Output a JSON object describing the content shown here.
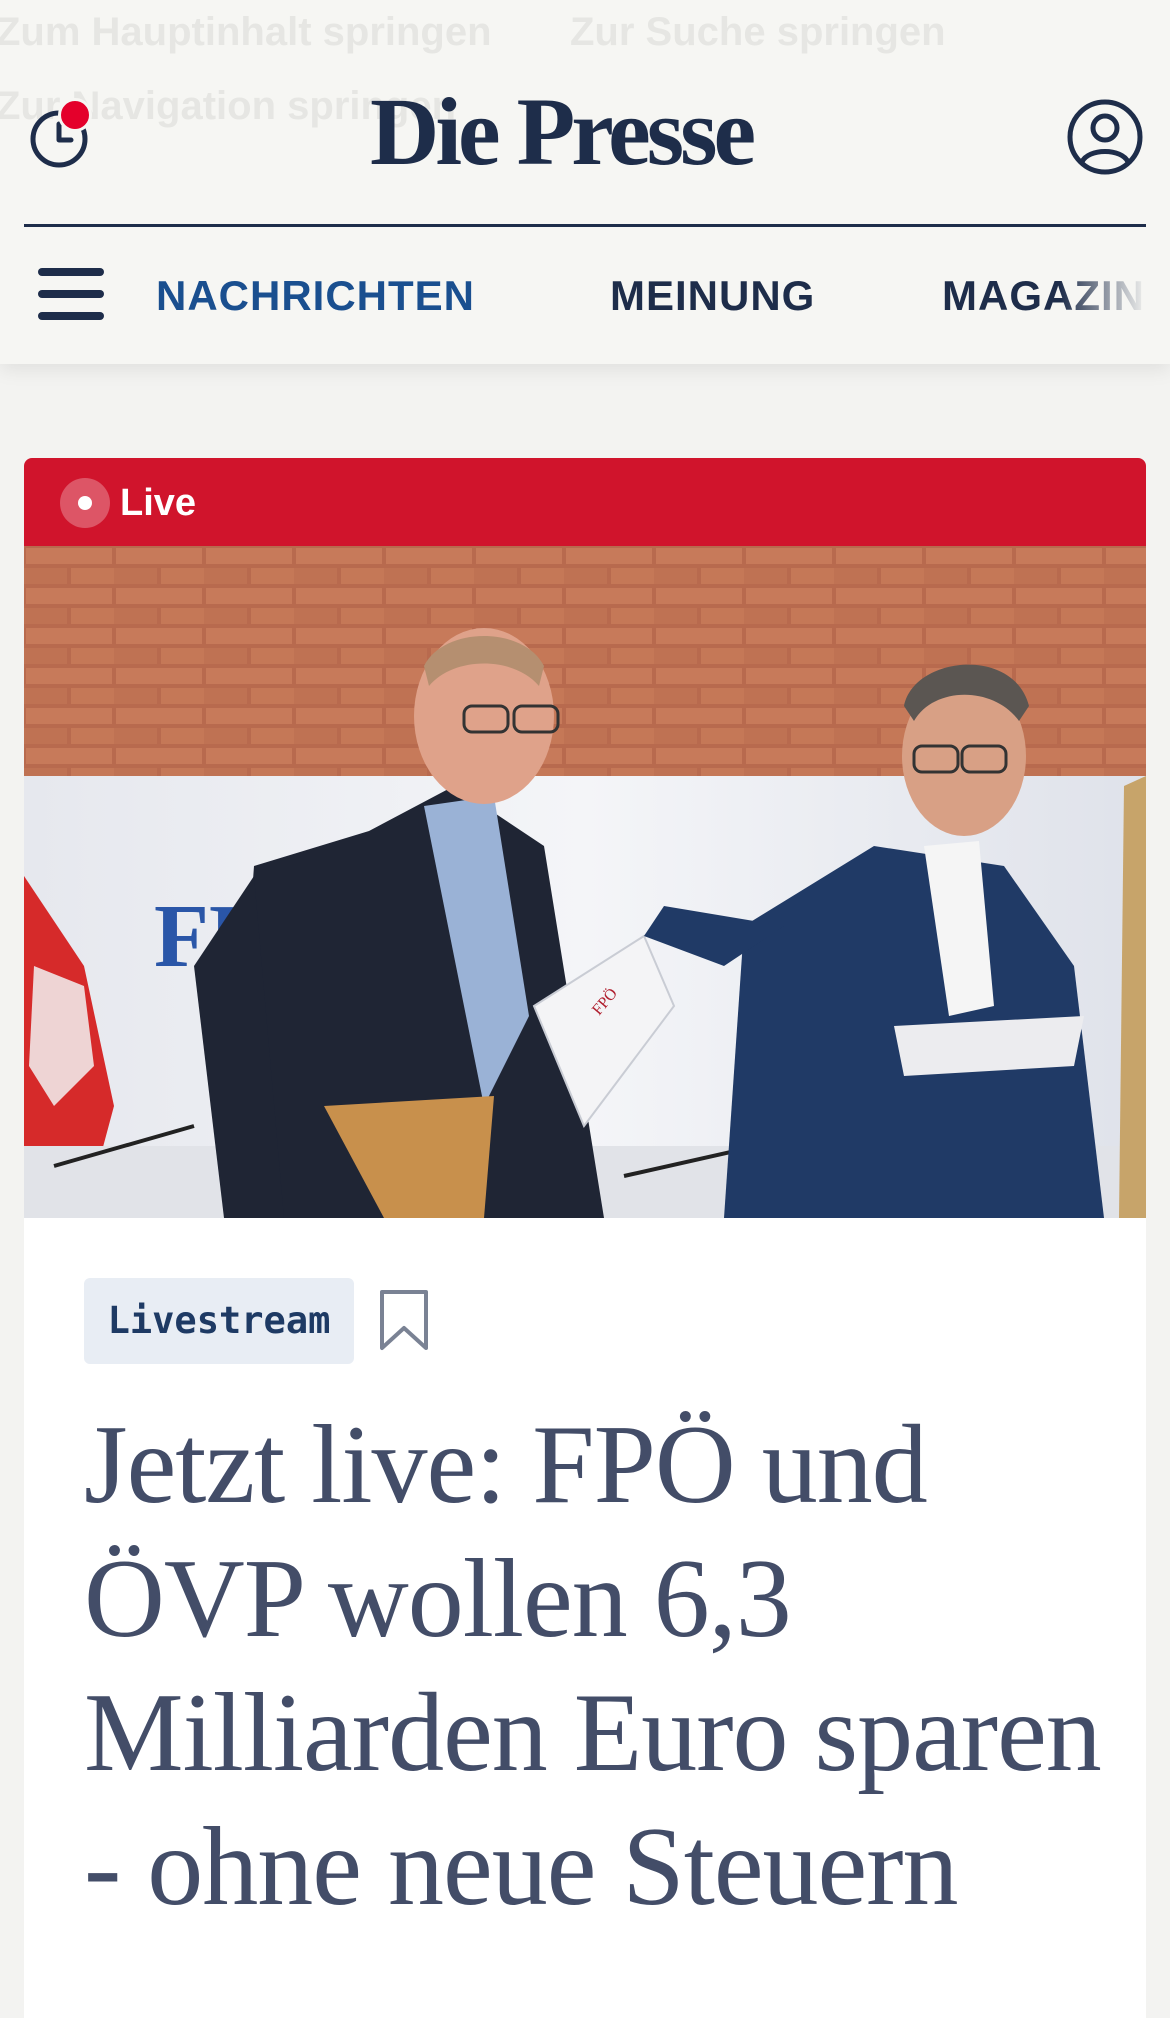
{
  "header": {
    "skip_links": [
      "Zum Hauptinhalt springen",
      "Zur Suche springen",
      "Zur Navigation springen"
    ],
    "logo": "Die Presse",
    "history_icon": "clock-icon",
    "account_icon": "user-icon",
    "menu_icon": "hamburger-icon",
    "nav_items": [
      "NACHRICHTEN",
      "MEINUNG",
      "MAGAZIN"
    ]
  },
  "colors": {
    "brand_navy": "#1e2d4a",
    "nav_active": "#1a4f8f",
    "live_red": "#d0142c",
    "notification": "#e4002b",
    "headline": "#434d68"
  },
  "article": {
    "live_badge": "Live",
    "tag": "Livestream",
    "bookmark_icon": "bookmark-icon",
    "headline": "Jetzt live: FPÖ und ÖVP wollen 6,3 Milliarden Euro sparen - ohne neue Steuern",
    "image": {
      "backdrop_text": "FPÖ",
      "folder_text": "FPÖ"
    }
  }
}
